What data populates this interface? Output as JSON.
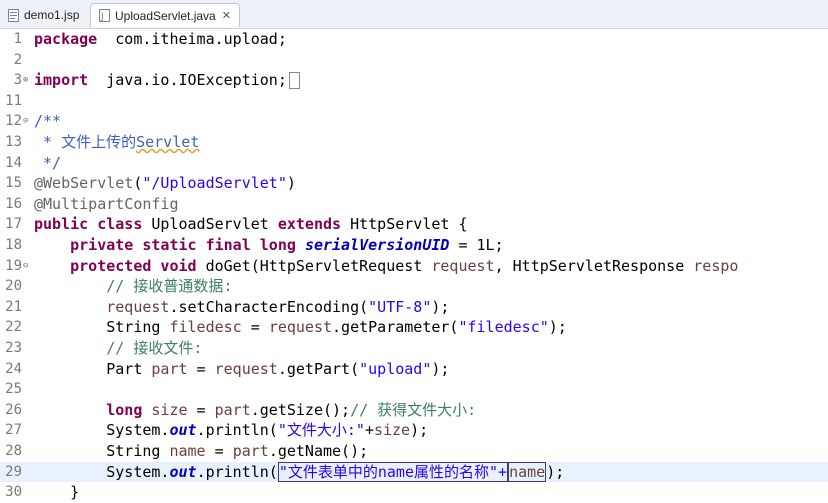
{
  "tabs": [
    {
      "label": "demo1.jsp",
      "active": false
    },
    {
      "label": "UploadServlet.java",
      "active": true,
      "close": "✕"
    }
  ],
  "lines": [
    {
      "n": "1",
      "fold": "",
      "parts": [
        [
          "kw",
          "package"
        ],
        [
          "",
          "  com.itheima.upload;"
        ]
      ]
    },
    {
      "n": "2",
      "fold": "",
      "parts": []
    },
    {
      "n": "3",
      "fold": "⊕",
      "parts": [
        [
          "kw",
          "import"
        ],
        [
          "",
          "  java.io.IOException;"
        ],
        [
          "box",
          ""
        ]
      ]
    },
    {
      "n": "11",
      "fold": "",
      "parts": []
    },
    {
      "n": "12",
      "fold": "⊖",
      "parts": [
        [
          "jdoc",
          "/**"
        ]
      ]
    },
    {
      "n": "13",
      "fold": "",
      "parts": [
        [
          "jdoc",
          " * 文件上传的"
        ],
        [
          "jdoc squig",
          "Servlet"
        ]
      ]
    },
    {
      "n": "14",
      "fold": "",
      "parts": [
        [
          "jdoc",
          " */"
        ]
      ]
    },
    {
      "n": "15",
      "fold": "",
      "parts": [
        [
          "ann",
          "@WebServlet"
        ],
        [
          "",
          "("
        ],
        [
          "str",
          "\"/UploadServlet\""
        ],
        [
          "",
          ")"
        ]
      ]
    },
    {
      "n": "16",
      "fold": "",
      "parts": [
        [
          "ann",
          "@MultipartConfig"
        ]
      ]
    },
    {
      "n": "17",
      "fold": "",
      "parts": [
        [
          "kw",
          "public class"
        ],
        [
          "",
          " UploadServlet "
        ],
        [
          "kw",
          "extends"
        ],
        [
          "",
          " HttpServlet {"
        ]
      ]
    },
    {
      "n": "18",
      "fold": "",
      "parts": [
        [
          "",
          "    "
        ],
        [
          "kw",
          "private static final long"
        ],
        [
          "",
          " "
        ],
        [
          "sfld",
          "serialVersionUID"
        ],
        [
          "",
          " = 1L;"
        ]
      ]
    },
    {
      "n": "19",
      "fold": "⊖",
      "parts": [
        [
          "",
          "    "
        ],
        [
          "kw",
          "protected void"
        ],
        [
          "",
          " doGet(HttpServletRequest "
        ],
        [
          "lv",
          "request"
        ],
        [
          "",
          ", HttpServletResponse "
        ],
        [
          "lv",
          "respo"
        ]
      ]
    },
    {
      "n": "20",
      "fold": "",
      "parts": [
        [
          "",
          "        "
        ],
        [
          "cmt",
          "// 接收普通数据:"
        ]
      ]
    },
    {
      "n": "21",
      "fold": "",
      "parts": [
        [
          "",
          "        "
        ],
        [
          "lv",
          "request"
        ],
        [
          "",
          ".setCharacterEncoding("
        ],
        [
          "str",
          "\"UTF-8\""
        ],
        [
          "",
          ");"
        ]
      ]
    },
    {
      "n": "22",
      "fold": "",
      "parts": [
        [
          "",
          "        String "
        ],
        [
          "lv",
          "filedesc"
        ],
        [
          "",
          " = "
        ],
        [
          "lv",
          "request"
        ],
        [
          "",
          ".getParameter("
        ],
        [
          "str",
          "\"filedesc\""
        ],
        [
          "",
          ");"
        ]
      ]
    },
    {
      "n": "23",
      "fold": "",
      "parts": [
        [
          "",
          "        "
        ],
        [
          "cmt",
          "// 接收文件:"
        ]
      ]
    },
    {
      "n": "24",
      "fold": "",
      "parts": [
        [
          "",
          "        Part "
        ],
        [
          "lv",
          "part"
        ],
        [
          "",
          " = "
        ],
        [
          "lv",
          "request"
        ],
        [
          "",
          ".getPart("
        ],
        [
          "str",
          "\"upload\""
        ],
        [
          "",
          ");"
        ]
      ]
    },
    {
      "n": "25",
      "fold": "",
      "parts": []
    },
    {
      "n": "26",
      "fold": "",
      "parts": [
        [
          "",
          "        "
        ],
        [
          "kw",
          "long"
        ],
        [
          "",
          " "
        ],
        [
          "lv",
          "size"
        ],
        [
          "",
          " = "
        ],
        [
          "lv",
          "part"
        ],
        [
          "",
          ".getSize();"
        ],
        [
          "cmt",
          "// 获得文件大小:"
        ]
      ]
    },
    {
      "n": "27",
      "fold": "",
      "parts": [
        [
          "",
          "        System."
        ],
        [
          "fld",
          "out"
        ],
        [
          "",
          ".println("
        ],
        [
          "str",
          "\"文件大小:\""
        ],
        [
          "",
          "+"
        ],
        [
          "lv",
          "size"
        ],
        [
          "",
          ");"
        ]
      ]
    },
    {
      "n": "28",
      "fold": "",
      "parts": [
        [
          "",
          "        String "
        ],
        [
          "lv",
          "name"
        ],
        [
          "",
          " = "
        ],
        [
          "lv",
          "part"
        ],
        [
          "",
          ".getName();"
        ]
      ]
    },
    {
      "n": "29",
      "fold": "",
      "current": true,
      "parts": [
        [
          "",
          "        System."
        ],
        [
          "fld",
          "out"
        ],
        [
          "",
          ".println("
        ],
        [
          "str sel",
          "\"文件表单中的name属性的名称\"+"
        ],
        [
          "lv sel",
          "name"
        ],
        [
          "",
          ");"
        ]
      ]
    },
    {
      "n": "30",
      "fold": "",
      "parts": [
        [
          "",
          "    }"
        ]
      ]
    }
  ]
}
